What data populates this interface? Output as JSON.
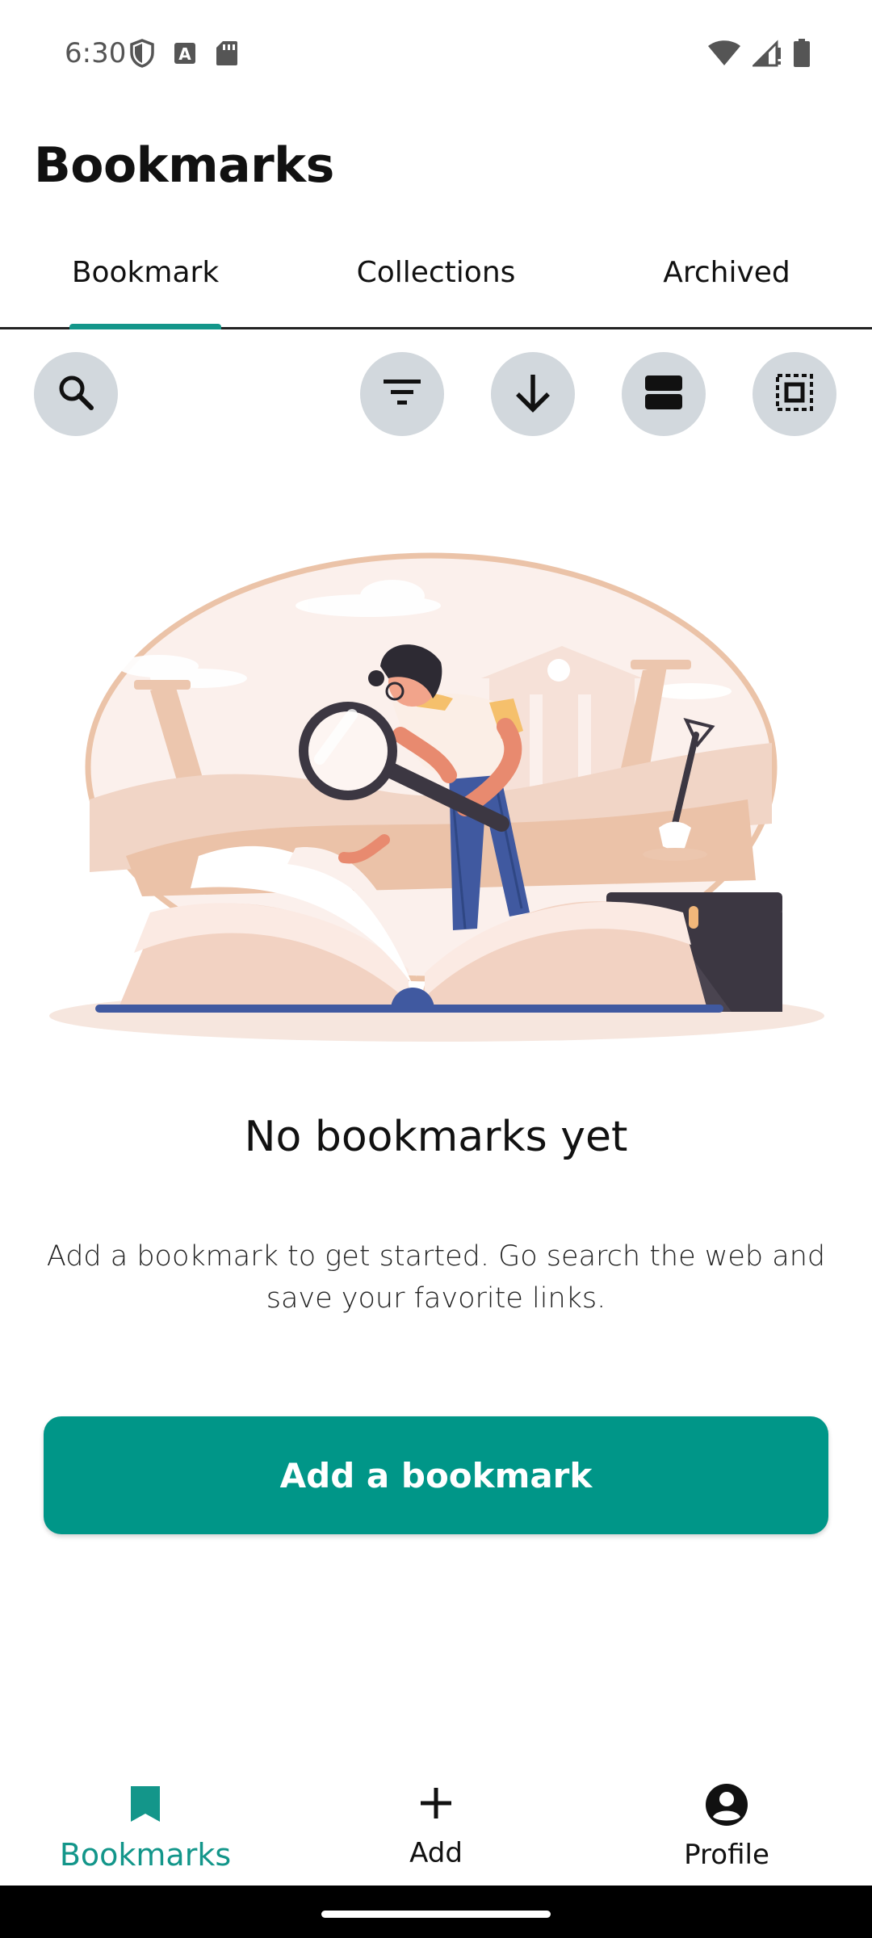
{
  "status_bar": {
    "time": "6:30",
    "left_icons": [
      "shield-icon",
      "font-icon",
      "sd-card-icon"
    ],
    "right_icons": [
      "wifi-icon",
      "signal-icon",
      "battery-icon"
    ]
  },
  "header": {
    "title": "Bookmarks"
  },
  "tabs": [
    {
      "label": "Bookmark",
      "active": true
    },
    {
      "label": "Collections",
      "active": false
    },
    {
      "label": "Archived",
      "active": false
    }
  ],
  "toolbar": {
    "buttons": [
      "search-icon",
      "filter-icon",
      "sort-down-icon",
      "view-layout-icon",
      "select-all-icon"
    ]
  },
  "empty_state": {
    "title": "No bookmarks yet",
    "description": "Add a bookmark to get started. Go search the web and save your favorite links.",
    "button_label": "Add a bookmark"
  },
  "bottom_nav": [
    {
      "label": "Bookmarks",
      "icon": "bookmark-icon",
      "active": true
    },
    {
      "label": "Add",
      "icon": "plus-icon",
      "active": false
    },
    {
      "label": "Profile",
      "icon": "account-circle-icon",
      "active": false
    }
  ],
  "colors": {
    "accent": "#009688",
    "tab_indicator": "#13968a",
    "toolbar_button_bg": "#d2d8dd"
  }
}
